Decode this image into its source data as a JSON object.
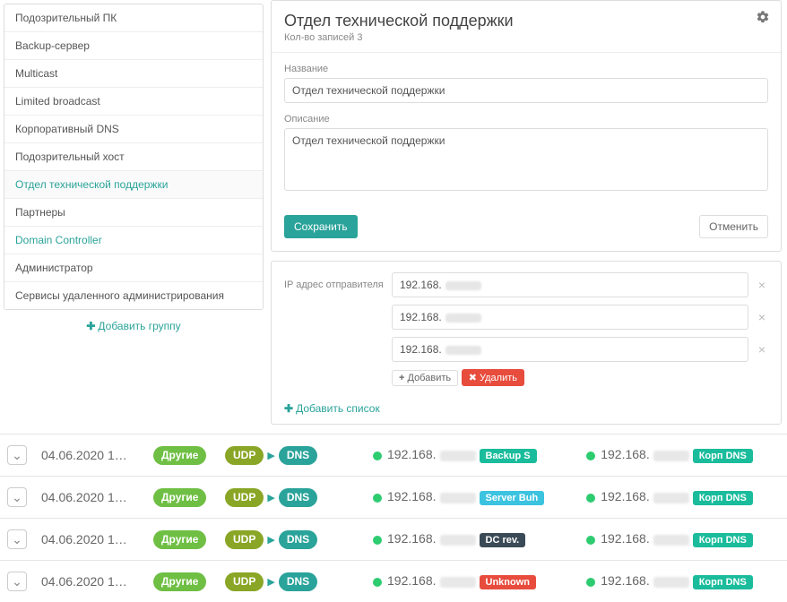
{
  "sidebar": {
    "items": [
      {
        "label": "Подозрительный ПК"
      },
      {
        "label": "Backup-сервер"
      },
      {
        "label": "Multicast"
      },
      {
        "label": "Limited broadcast"
      },
      {
        "label": "Корпоративный DNS"
      },
      {
        "label": "Подозрительный хост"
      },
      {
        "label": "Отдел технической поддержки",
        "active": true
      },
      {
        "label": "Партнеры"
      },
      {
        "label": "Domain Controller",
        "hint": true
      },
      {
        "label": "Администратор"
      },
      {
        "label": "Сервисы удаленного администрирования"
      }
    ],
    "add_group": "Добавить группу"
  },
  "panel": {
    "title": "Отдел технической поддержки",
    "records": "Кол-во записей 3",
    "name_label": "Название",
    "name_value": "Отдел технической поддержки",
    "desc_label": "Описание",
    "desc_value": "Отдел технической поддержки",
    "save": "Сохранить",
    "cancel": "Отменить"
  },
  "ip_block": {
    "label": "IP адрес отправителя",
    "prefix": "192.168",
    "rows": 3,
    "add": "Добавить",
    "delete": "Удалить",
    "add_list": "Добавить список"
  },
  "logs": {
    "date": "04.06.2020 1…",
    "type": "Другие",
    "proto1": "UDP",
    "proto2": "DNS",
    "ip_prefix": "192.168",
    "dst_tag": "Корп DNS",
    "rows": [
      {
        "src_tag": "Backup S",
        "src_color": "teal"
      },
      {
        "src_tag": "Server Buh",
        "src_color": "cyan"
      },
      {
        "src_tag": "DC rev.",
        "src_color": "dark"
      },
      {
        "src_tag": "Unknown",
        "src_color": "red"
      }
    ]
  }
}
